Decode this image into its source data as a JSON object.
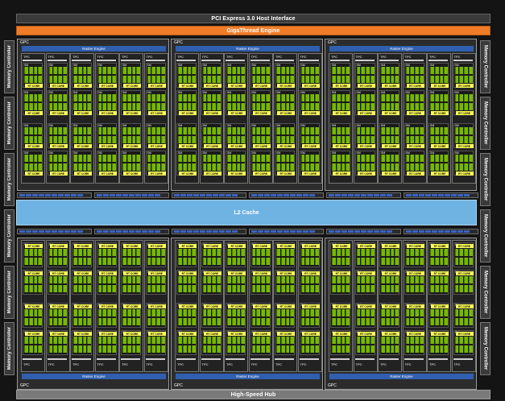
{
  "diagram": {
    "pcie_label": "PCI Express 3.0 Host Interface",
    "gigathread_label": "GigaThread Engine",
    "l2_label": "L2 Cache",
    "hub_label": "High-Speed Hub",
    "memory_controller_label": "Memory Controller",
    "gpc_label": "GPC",
    "raster_label": "Raster Engine",
    "tpc_label": "TPC",
    "sm_label": "SM",
    "rt_core_label": "RT CORE",
    "polymorph_label": "PolyMorph Engine",
    "colors": {
      "pcie": "#3a3a3a",
      "gigathread": "#f07c28",
      "l2": "#6fb3e2",
      "cores": "#77b800",
      "rt_core": "#ffff5a",
      "raster": "#2f5fae",
      "hub": "#7a7a7a"
    },
    "left_memory_controllers": 6,
    "right_memory_controllers": 6,
    "gpc_rows": 2,
    "gpcs_per_row": 3,
    "tpcs_per_gpc": 6,
    "sms_per_tpc": 2
  }
}
